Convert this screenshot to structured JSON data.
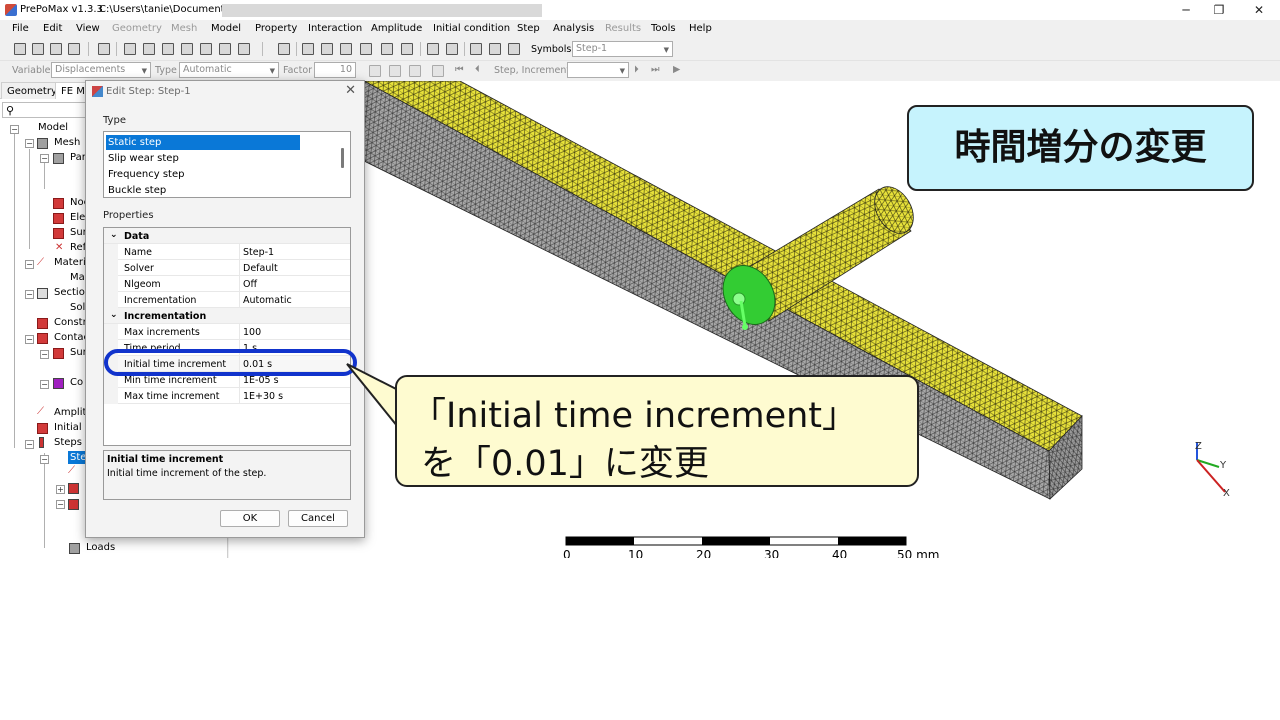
{
  "window": {
    "title": "PrePoMax v1.3.3",
    "path": "C:\\Users\\tanie\\Documents\\N",
    "minimize": "─",
    "maximize": "❐",
    "close": "✕"
  },
  "menu": [
    {
      "label": "File",
      "enabled": true
    },
    {
      "label": "Edit",
      "enabled": true
    },
    {
      "label": "View",
      "enabled": true
    },
    {
      "label": "Geometry",
      "enabled": false
    },
    {
      "label": "Mesh",
      "enabled": false
    },
    {
      "label": "Model",
      "enabled": true
    },
    {
      "label": "Property",
      "enabled": true
    },
    {
      "label": "Interaction",
      "enabled": true
    },
    {
      "label": "Amplitude",
      "enabled": true
    },
    {
      "label": "Initial condition",
      "enabled": true
    },
    {
      "label": "Step",
      "enabled": true
    },
    {
      "label": "Analysis",
      "enabled": true
    },
    {
      "label": "Results",
      "enabled": false
    },
    {
      "label": "Tools",
      "enabled": true
    },
    {
      "label": "Help",
      "enabled": true
    }
  ],
  "toolbar1": {
    "symbols_label": "Symbols",
    "symbols_value": "Step-1"
  },
  "toolbar2": {
    "variable_label": "Variable",
    "variable_value": "Displacements",
    "type_label": "Type",
    "type_value": "Automatic",
    "factor_label": "Factor",
    "factor_value": "10",
    "step_increment_label": "Step, Increment",
    "step_increment_value": ""
  },
  "left_panel": {
    "tabs": [
      "Geometry",
      "FE Mo"
    ],
    "tree": [
      {
        "label": "Model"
      },
      {
        "label": "Mesh"
      },
      {
        "label": "Par"
      },
      {
        "label": "Noc"
      },
      {
        "label": "Elem"
      },
      {
        "label": "Surf"
      },
      {
        "label": "Ref"
      },
      {
        "label": "Materia"
      },
      {
        "label": "Ma"
      },
      {
        "label": "Section"
      },
      {
        "label": "Sol"
      },
      {
        "label": "Constr"
      },
      {
        "label": "Contac"
      },
      {
        "label": "Sur"
      },
      {
        "label": "Co"
      },
      {
        "label": "Amplit"
      },
      {
        "label": "Initial c"
      },
      {
        "label": "Steps ("
      },
      {
        "label": "Ste"
      },
      {
        "label": "Loads"
      }
    ]
  },
  "dialog": {
    "title": "Edit Step: Step-1",
    "close": "✕",
    "type_group_label": "Type",
    "type_list": [
      {
        "label": "Static step",
        "selected": true
      },
      {
        "label": "Slip wear step",
        "selected": false
      },
      {
        "label": "Frequency step",
        "selected": false
      },
      {
        "label": "Buckle step",
        "selected": false
      }
    ],
    "properties_group_label": "Properties",
    "properties": [
      {
        "category": true,
        "name": "Data"
      },
      {
        "name": "Name",
        "value": "Step-1"
      },
      {
        "name": "Solver",
        "value": "Default"
      },
      {
        "name": "Nlgeom",
        "value": "Off"
      },
      {
        "name": "Incrementation",
        "value": "Automatic"
      },
      {
        "category": true,
        "name": "Incrementation"
      },
      {
        "name": "Max increments",
        "value": "100"
      },
      {
        "name": "Time period",
        "value": "1 s"
      },
      {
        "name": "Initial time increment",
        "value": "0.01 s"
      },
      {
        "name": "Min time increment",
        "value": "1E-05 s"
      },
      {
        "name": "Max time increment",
        "value": "1E+30 s"
      }
    ],
    "description_title": "Initial time increment",
    "description_text": "Initial time increment of the step.",
    "ok_label": "OK",
    "cancel_label": "Cancel"
  },
  "callouts": {
    "title": "時間増分の変更",
    "main_line1": "「Initial time increment」",
    "main_line2": "を「0.01」に変更"
  },
  "scale_bar": {
    "ticks": [
      "0",
      "10",
      "20",
      "30",
      "40",
      "50 mm"
    ]
  },
  "axes": {
    "z": "Z",
    "y": "Y",
    "x": "X"
  },
  "colors": {
    "accent_blue": "#0a78d7",
    "highlight_oval": "#1133cc",
    "title_callout_bg": "#c6f3fd",
    "main_callout_bg": "#fefbd0",
    "mesh_yellow": "#e8e23a",
    "mesh_gray": "#a8a8a8",
    "contact_green": "#33cc33"
  }
}
